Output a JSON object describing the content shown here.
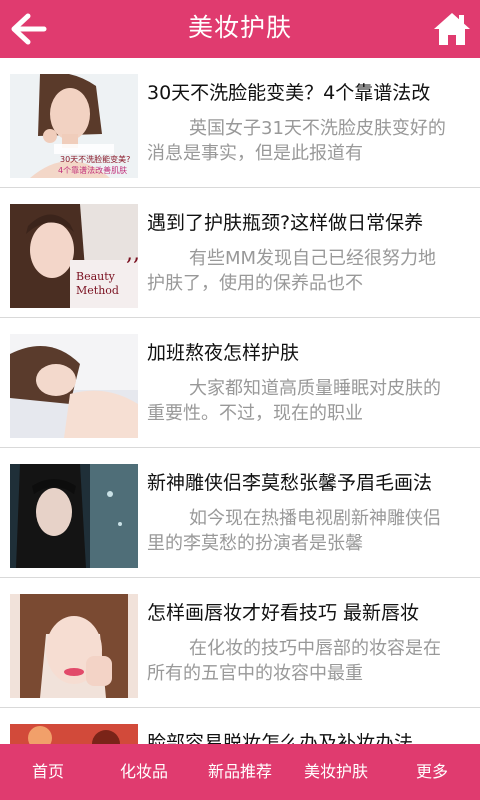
{
  "header": {
    "title": "美妆护肤",
    "back_icon": "back-arrow-icon",
    "home_icon": "home-icon"
  },
  "articles": [
    {
      "title": "30天不洗脸能变美？4个靠谱法改",
      "desc": "英国女子31天不洗脸皮肤变好的消息是事实，但是此报道有",
      "thumb_text_1": "30天不洗脸能变美?",
      "thumb_text_2": "4个靠谱法改善肌肤"
    },
    {
      "title": "遇到了护肤瓶颈?这样做日常保养",
      "desc": "有些MM发现自己已经很努力地护肤了，使用的保养品也不",
      "thumb_text_1": "Beauty",
      "thumb_text_2": "Method"
    },
    {
      "title": "加班熬夜怎样护肤",
      "desc": "大家都知道高质量睡眠对皮肤的重要性。不过，现在的职业"
    },
    {
      "title": "新神雕侠侣李莫愁张馨予眉毛画法",
      "desc": "如今现在热播电视剧新神雕侠侣里的李莫愁的扮演者是张馨"
    },
    {
      "title": "怎样画唇妆才好看技巧 最新唇妆",
      "desc": "在化妆的技巧中唇部的妆容是在所有的五官中的妆容中最重"
    },
    {
      "title": "脸部容易脱妆怎么办及补妆办法",
      "desc": ""
    }
  ],
  "tabs": [
    {
      "label": "首页"
    },
    {
      "label": "化妆品"
    },
    {
      "label": "新品推荐"
    },
    {
      "label": "美妆护肤"
    },
    {
      "label": "更多"
    }
  ],
  "colors": {
    "accent": "#e03b6f",
    "title_text": "#111111",
    "desc_text": "#999999"
  }
}
